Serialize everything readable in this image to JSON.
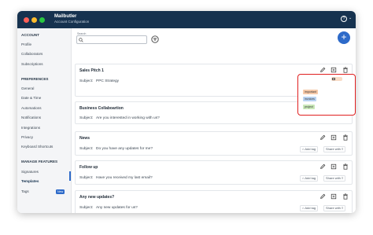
{
  "app": {
    "title": "Mailbutler",
    "subtitle": "Account Configuration"
  },
  "sidebar": {
    "sections": [
      {
        "heading": "ACCOUNT",
        "items": [
          "Profile",
          "Collaborators",
          "Subscriptions"
        ]
      },
      {
        "heading": "PREFERENCES",
        "items": [
          "General",
          "Date & Time",
          "Automations",
          "Notifications",
          "Integrations",
          "Privacy",
          "Keyboard Shortcuts"
        ]
      },
      {
        "heading": "MANAGE FEATURES",
        "items": [
          "Signatures",
          "Templates",
          "Tags"
        ]
      }
    ],
    "active_item": "Templates",
    "new_badge": "New"
  },
  "search": {
    "label": "Search",
    "value": ""
  },
  "templates": [
    {
      "title": "Sales Pitch 1",
      "subject_label": "Subject:",
      "subject": "PPC Strategy",
      "share_label": "Share with"
    },
    {
      "title": "Business Collaboartion",
      "subject_label": "Subject:",
      "subject": "Are you interested in working with us?"
    },
    {
      "title": "News",
      "subject_label": "Subject:",
      "subject": "Do you have any updates for me?",
      "tag_label": "Add tag",
      "share_label": "Share with"
    },
    {
      "title": "Follow up",
      "subject_label": "Subject:",
      "subject": "Have you received my last email?",
      "tag_label": "Add tag",
      "share_label": "Share with"
    },
    {
      "title": "Any new updates?",
      "subject_label": "Subject:",
      "subject": "Any new updates for us?",
      "tag_label": "Add tag",
      "share_label": "Share with"
    }
  ],
  "tag_popup": {
    "tags": [
      {
        "label": "important",
        "color": "#f6c9a8"
      },
      {
        "label": "invoices",
        "color": "#b9d3f2"
      },
      {
        "label": "project",
        "color": "#c9e8b8"
      }
    ]
  },
  "colors": {
    "titlebar": "#16324f",
    "accent": "#2d6ac9",
    "highlight": "#e02020"
  },
  "icons": [
    "search-icon",
    "filter-icon",
    "plus-icon",
    "edit-icon",
    "duplicate-icon",
    "trash-icon",
    "tag-icon",
    "share-icon",
    "help-icon",
    "chevron-down-icon"
  ]
}
